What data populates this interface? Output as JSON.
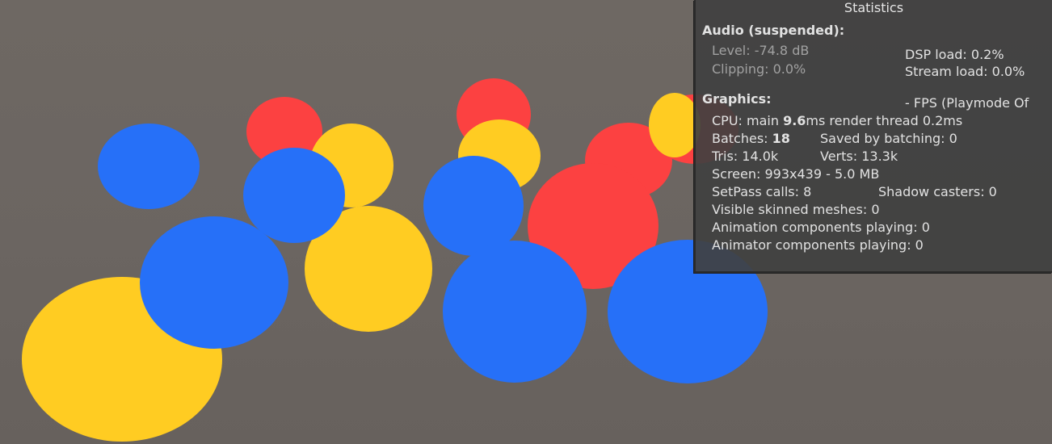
{
  "scene": {
    "background": "#6b6561",
    "colors": {
      "red": "#fc4141",
      "yellow": "#ffcc22",
      "blue": "#2670f8"
    },
    "spheres": [
      {
        "color": "red"
      },
      {
        "color": "red"
      },
      {
        "color": "red"
      },
      {
        "color": "red"
      },
      {
        "color": "red"
      },
      {
        "color": "yellow"
      },
      {
        "color": "yellow"
      },
      {
        "color": "yellow"
      },
      {
        "color": "yellow"
      },
      {
        "color": "yellow"
      },
      {
        "color": "blue"
      },
      {
        "color": "blue"
      },
      {
        "color": "blue"
      },
      {
        "color": "blue"
      },
      {
        "color": "blue"
      },
      {
        "color": "blue"
      }
    ]
  },
  "stats": {
    "title": "Statistics",
    "audio": {
      "heading": "Audio (suspended):",
      "level": "Level: -74.8 dB",
      "clipping": "Clipping: 0.0%",
      "dsp_load": "DSP load: 0.2%",
      "stream_load": "Stream load: 0.0%"
    },
    "graphics": {
      "heading": "Graphics:",
      "fps": "- FPS (Playmode Of",
      "cpu_prefix": "CPU: main ",
      "cpu_main": "9.6",
      "cpu_suffix": "ms  render thread 0.2ms",
      "batches_label": "Batches: ",
      "batches_value": "18",
      "saved_by_batching": "Saved by batching: 0",
      "tris": "Tris: 14.0k",
      "verts": "Verts: 13.3k",
      "screen": "Screen: 993x439 - 5.0 MB",
      "setpass": "SetPass calls: 8",
      "shadow_casters": "Shadow casters: 0",
      "skinned_meshes": "Visible skinned meshes: 0",
      "animation_components": "Animation components playing: 0",
      "animator_components": "Animator components playing: 0"
    }
  }
}
